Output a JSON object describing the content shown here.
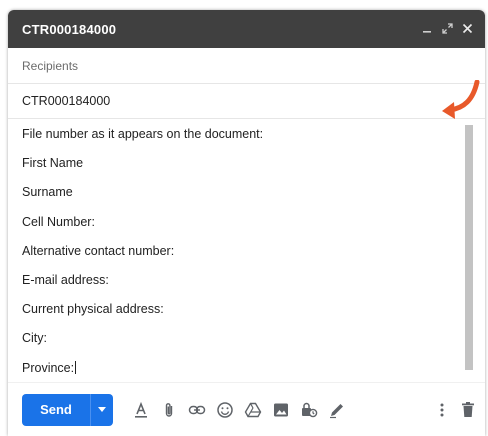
{
  "window": {
    "title": "CTR000184000",
    "controls": [
      "minimize-icon",
      "expand-icon",
      "close-icon"
    ]
  },
  "recipients": {
    "placeholder": "Recipients"
  },
  "subject": {
    "value": "CTR000184000"
  },
  "body": {
    "lines": [
      "File number as it appears on the document:",
      "First Name",
      "Surname",
      "Cell Number:",
      "Alternative contact number:",
      "E-mail address:",
      "Current physical address:",
      "City:",
      "Province:"
    ]
  },
  "toolbar": {
    "send_label": "Send",
    "icons": [
      "format-text-icon",
      "attach-icon",
      "link-icon",
      "emoji-icon",
      "drive-icon",
      "photo-icon",
      "confidential-mode-icon",
      "signature-icon",
      "more-options-icon",
      "discard-icon"
    ]
  },
  "colors": {
    "title_bar": "#404040",
    "send_button": "#1a73e8",
    "annotation_arrow": "#e8592a",
    "scrollbar": "#c3c3c3"
  },
  "annotation": {
    "icon": "curved-arrow-icon",
    "color": "#e8592a"
  }
}
